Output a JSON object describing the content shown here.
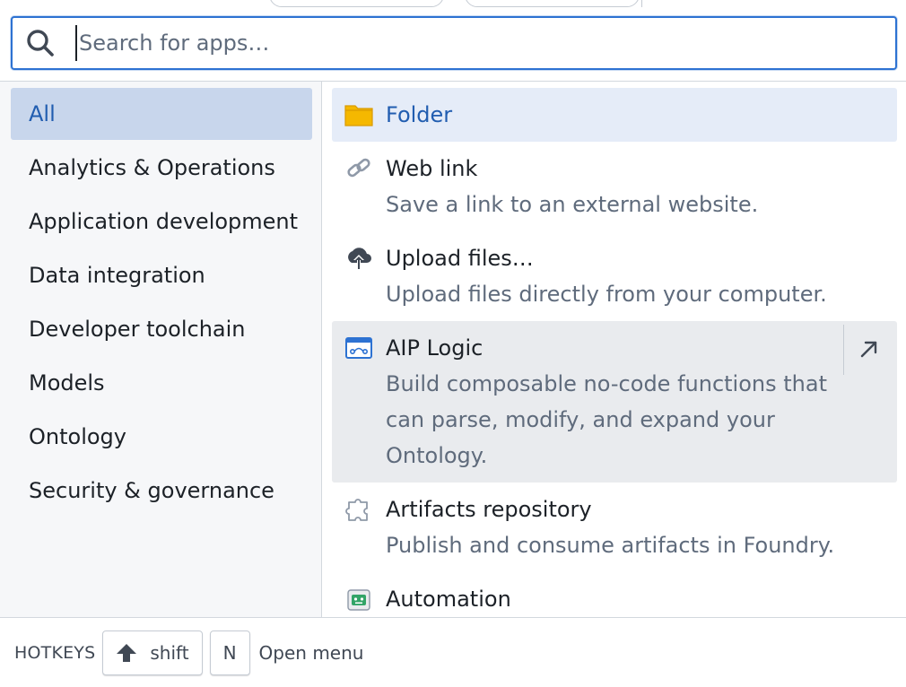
{
  "search": {
    "placeholder": "Search for apps…"
  },
  "sidebar": {
    "items": [
      {
        "label": "All"
      },
      {
        "label": "Analytics & Operations"
      },
      {
        "label": "Application development"
      },
      {
        "label": "Data integration"
      },
      {
        "label": "Developer toolchain"
      },
      {
        "label": "Models"
      },
      {
        "label": "Ontology"
      },
      {
        "label": "Security & governance"
      }
    ]
  },
  "apps": [
    {
      "title": "Folder",
      "description": "",
      "icon": "folder-icon"
    },
    {
      "title": "Web link",
      "description": "Save a link to an external website.",
      "icon": "link-icon"
    },
    {
      "title": "Upload files…",
      "description": "Upload files directly from your computer.",
      "icon": "cloud-upload-icon"
    },
    {
      "title": "AIP Logic",
      "description": "Build composable no-code functions that can parse, modify, and expand your Ontology.",
      "icon": "aip-logic-icon"
    },
    {
      "title": "Artifacts repository",
      "description": "Publish and consume artifacts in Foundry.",
      "icon": "puzzle-icon"
    },
    {
      "title": "Automation",
      "description": "",
      "icon": "robot-icon"
    }
  ],
  "footer": {
    "hotkeys_label": "HOTKEYS",
    "shift_key": "shift",
    "n_key": "N",
    "hint": "Open menu"
  },
  "colors": {
    "accent": "#2d72d2",
    "active_bg": "#c8d6ec",
    "selected_bg": "#e5ecf8",
    "folder": "#f5b800"
  }
}
